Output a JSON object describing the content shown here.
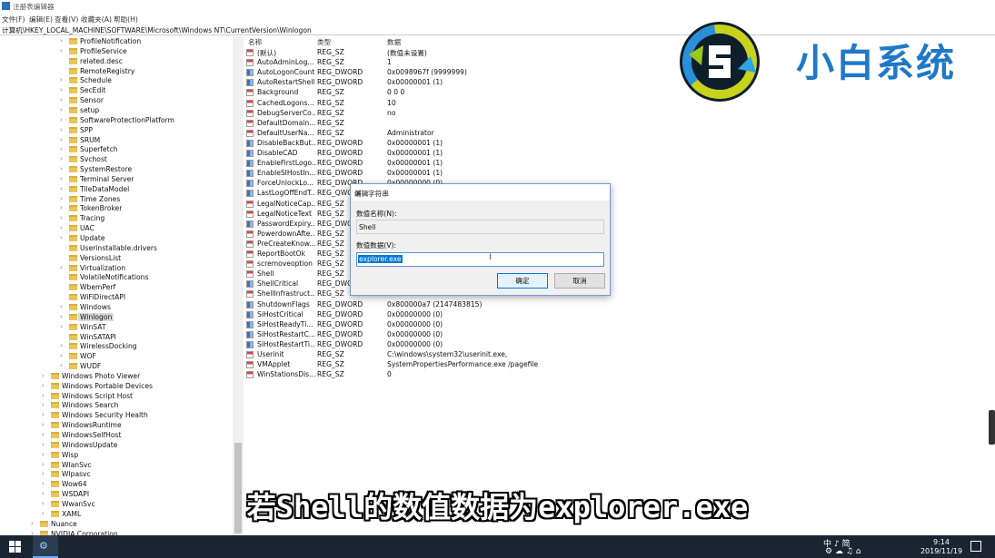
{
  "window": {
    "title": "注册表编辑器"
  },
  "menu": [
    "文件(F)",
    "编辑(E)",
    "查看(V)",
    "收藏夹(A)",
    "帮助(H)"
  ],
  "address": "计算机\\HKEY_LOCAL_MACHINE\\SOFTWARE\\Microsoft\\Windows NT\\CurrentVersion\\Winlogon",
  "tree": {
    "items": [
      {
        "label": "ProfileNotification",
        "level": 2,
        "arrow": true
      },
      {
        "label": "ProfileService",
        "level": 2,
        "arrow": true
      },
      {
        "label": "related.desc",
        "level": 2,
        "arrow": false
      },
      {
        "label": "RemoteRegistry",
        "level": 2,
        "arrow": false
      },
      {
        "label": "Schedule",
        "level": 2,
        "arrow": true
      },
      {
        "label": "SecEdit",
        "level": 2,
        "arrow": true
      },
      {
        "label": "Sensor",
        "level": 2,
        "arrow": true
      },
      {
        "label": "setup",
        "level": 2,
        "arrow": true
      },
      {
        "label": "SoftwareProtectionPlatform",
        "level": 2,
        "arrow": true
      },
      {
        "label": "SPP",
        "level": 2,
        "arrow": true
      },
      {
        "label": "SRUM",
        "level": 2,
        "arrow": true
      },
      {
        "label": "Superfetch",
        "level": 2,
        "arrow": true
      },
      {
        "label": "Svchost",
        "level": 2,
        "arrow": true
      },
      {
        "label": "SystemRestore",
        "level": 2,
        "arrow": true
      },
      {
        "label": "Terminal Server",
        "level": 2,
        "arrow": true
      },
      {
        "label": "TileDataModel",
        "level": 2,
        "arrow": true
      },
      {
        "label": "Time Zones",
        "level": 2,
        "arrow": true
      },
      {
        "label": "TokenBroker",
        "level": 2,
        "arrow": true
      },
      {
        "label": "Tracing",
        "level": 2,
        "arrow": true
      },
      {
        "label": "UAC",
        "level": 2,
        "arrow": true
      },
      {
        "label": "Update",
        "level": 2,
        "arrow": true
      },
      {
        "label": "Userinstallable.drivers",
        "level": 2,
        "arrow": false
      },
      {
        "label": "VersionsList",
        "level": 2,
        "arrow": false
      },
      {
        "label": "Virtualization",
        "level": 2,
        "arrow": true
      },
      {
        "label": "VolatileNotifications",
        "level": 2,
        "arrow": false
      },
      {
        "label": "WbemPerf",
        "level": 2,
        "arrow": false
      },
      {
        "label": "WiFiDirectAPI",
        "level": 2,
        "arrow": false
      },
      {
        "label": "Windows",
        "level": 2,
        "arrow": true
      },
      {
        "label": "Winlogon",
        "level": 2,
        "arrow": true,
        "selected": true
      },
      {
        "label": "WinSAT",
        "level": 2,
        "arrow": true
      },
      {
        "label": "WinSATAPI",
        "level": 2,
        "arrow": false
      },
      {
        "label": "WirelessDocking",
        "level": 2,
        "arrow": true
      },
      {
        "label": "WOF",
        "level": 2,
        "arrow": true
      },
      {
        "label": "WUDF",
        "level": 2,
        "arrow": true
      },
      {
        "label": "Windows Photo Viewer",
        "level": 1,
        "arrow": true
      },
      {
        "label": "Windows Portable Devices",
        "level": 1,
        "arrow": true
      },
      {
        "label": "Windows Script Host",
        "level": 1,
        "arrow": true
      },
      {
        "label": "Windows Search",
        "level": 1,
        "arrow": true
      },
      {
        "label": "Windows Security Health",
        "level": 1,
        "arrow": true
      },
      {
        "label": "WindowsRuntime",
        "level": 1,
        "arrow": true
      },
      {
        "label": "WindowsSelfHost",
        "level": 1,
        "arrow": true
      },
      {
        "label": "WindowsUpdate",
        "level": 1,
        "arrow": true
      },
      {
        "label": "Wisp",
        "level": 1,
        "arrow": true
      },
      {
        "label": "WlanSvc",
        "level": 1,
        "arrow": true
      },
      {
        "label": "Wlpasvc",
        "level": 1,
        "arrow": true
      },
      {
        "label": "Wow64",
        "level": 1,
        "arrow": true
      },
      {
        "label": "WSDAPI",
        "level": 1,
        "arrow": true
      },
      {
        "label": "WwanSvc",
        "level": 1,
        "arrow": true
      },
      {
        "label": "XAML",
        "level": 1,
        "arrow": true
      },
      {
        "label": "Nuance",
        "level": 0,
        "arrow": true
      },
      {
        "label": "NVIDIA Corporation",
        "level": 0,
        "arrow": true
      }
    ]
  },
  "list": {
    "headers": {
      "name": "名称",
      "type": "类型",
      "data": "数据"
    },
    "rows": [
      {
        "name": "(默认)",
        "type": "REG_SZ",
        "data": "(数值未设置)"
      },
      {
        "name": "AutoAdminLog...",
        "type": "REG_SZ",
        "data": "1"
      },
      {
        "name": "AutoLogonCount",
        "type": "REG_DWORD",
        "data": "0x0098967f (9999999)"
      },
      {
        "name": "AutoRestartShell",
        "type": "REG_DWORD",
        "data": "0x00000001 (1)"
      },
      {
        "name": "Background",
        "type": "REG_SZ",
        "data": "0 0 0"
      },
      {
        "name": "CachedLogons...",
        "type": "REG_SZ",
        "data": "10"
      },
      {
        "name": "DebugServerCo...",
        "type": "REG_SZ",
        "data": "no"
      },
      {
        "name": "DefaultDomain...",
        "type": "REG_SZ",
        "data": ""
      },
      {
        "name": "DefaultUserNa...",
        "type": "REG_SZ",
        "data": "Administrator"
      },
      {
        "name": "DisableBackBut...",
        "type": "REG_DWORD",
        "data": "0x00000001 (1)"
      },
      {
        "name": "DisableCAD",
        "type": "REG_DWORD",
        "data": "0x00000001 (1)"
      },
      {
        "name": "EnableFirstLogo...",
        "type": "REG_DWORD",
        "data": "0x00000001 (1)"
      },
      {
        "name": "EnableSIHostIn...",
        "type": "REG_DWORD",
        "data": "0x00000001 (1)"
      },
      {
        "name": "ForceUnlockLo...",
        "type": "REG_DWORD",
        "data": "0x00000000 (0)"
      },
      {
        "name": "LastLogOffEndT...",
        "type": "REG_QWORD",
        "data": ""
      },
      {
        "name": "LegalNoticeCap...",
        "type": "REG_SZ",
        "data": ""
      },
      {
        "name": "LegalNoticeText",
        "type": "REG_SZ",
        "data": ""
      },
      {
        "name": "PasswordExpiry...",
        "type": "REG_DWORD",
        "data": ""
      },
      {
        "name": "PowerdownAfte...",
        "type": "REG_SZ",
        "data": ""
      },
      {
        "name": "PreCreateKnow...",
        "type": "REG_SZ",
        "data": ""
      },
      {
        "name": "ReportBootOk",
        "type": "REG_SZ",
        "data": ""
      },
      {
        "name": "scremoveoption",
        "type": "REG_SZ",
        "data": ""
      },
      {
        "name": "Shell",
        "type": "REG_SZ",
        "data": ""
      },
      {
        "name": "ShellCritical",
        "type": "REG_DWORD",
        "data": ""
      },
      {
        "name": "ShellInfrastruct...",
        "type": "REG_SZ",
        "data": ""
      },
      {
        "name": "ShutdownFlags",
        "type": "REG_DWORD",
        "data": "0x800000a7 (2147483815)"
      },
      {
        "name": "SiHostCritical",
        "type": "REG_DWORD",
        "data": "0x00000000 (0)"
      },
      {
        "name": "SiHostReadyTi...",
        "type": "REG_DWORD",
        "data": "0x00000000 (0)"
      },
      {
        "name": "SiHostRestartC...",
        "type": "REG_DWORD",
        "data": "0x00000000 (0)"
      },
      {
        "name": "SiHostRestartTi...",
        "type": "REG_DWORD",
        "data": "0x00000000 (0)"
      },
      {
        "name": "Userinit",
        "type": "REG_SZ",
        "data": "C:\\windows\\system32\\userinit.exe,"
      },
      {
        "name": "VMApplet",
        "type": "REG_SZ",
        "data": "SystemPropertiesPerformance.exe /pagefile"
      },
      {
        "name": "WinStationsDis...",
        "type": "REG_SZ",
        "data": "0"
      }
    ]
  },
  "dialog": {
    "title": "编辑字符串",
    "name_label": "数值名称(N):",
    "name_value": "Shell",
    "data_label": "数值数据(V):",
    "data_value": "explorer.exe",
    "ok": "确定",
    "cancel": "取消"
  },
  "watermark": {
    "brand_text": "小白系统"
  },
  "subtitle": "若Shell的数值数据为explorer.exe",
  "taskbar": {
    "tray_top": "中 ♪ 简",
    "tray_bottom": "⚙ ☁ ♫ ⌂",
    "time": "9:14",
    "date": "2019/11/19"
  },
  "colors": {
    "accent": "#0078d7",
    "brand": "#1f78c8",
    "taskbar": "#1b2531",
    "folder": "#e9c45a"
  }
}
